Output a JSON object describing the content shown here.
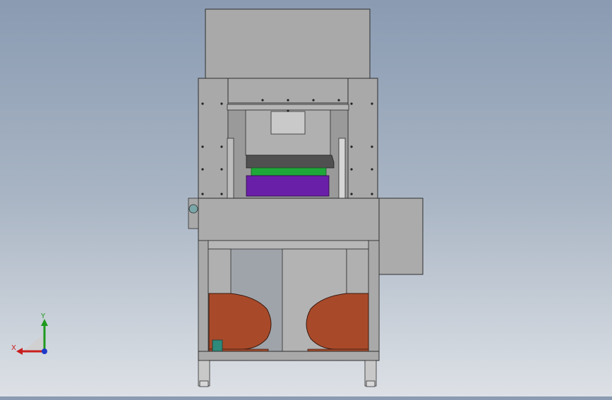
{
  "viewport": {
    "background_top": "#8a9bb2",
    "background_bottom": "#dde1e6"
  },
  "model": {
    "colors": {
      "steel": "#a9a9a9",
      "steel_dark": "#7c7c7c",
      "outline": "#2e2e2e",
      "punch_plate": "#505050",
      "green_plate": "#1fa83a",
      "purple_block": "#6a1fa8",
      "blower": "#a84a2a",
      "teal_part": "#2e8a7a",
      "feet": "#c8c8c8"
    }
  },
  "triad": {
    "x_label": "X",
    "y_label": "Y",
    "x_color": "#c81e1e",
    "y_color": "#1e9a1e",
    "z_color": "#1e3ac8"
  }
}
